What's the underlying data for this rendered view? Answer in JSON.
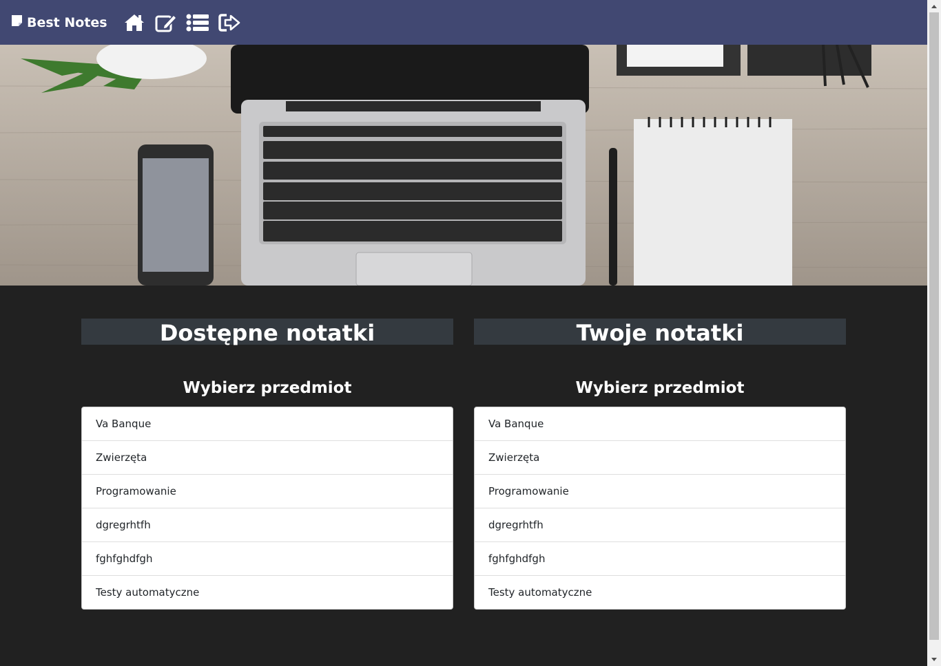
{
  "navbar": {
    "brand": "Best Notes",
    "icons": [
      "note-icon",
      "home-icon",
      "edit-icon",
      "list-icon",
      "logout-icon"
    ]
  },
  "colors": {
    "navbar_bg": "#414872",
    "page_bg": "#212121",
    "header_bg": "#343a40"
  },
  "left": {
    "title": "Dostępne notatki",
    "subtitle": "Wybierz przedmiot",
    "items": [
      {
        "label": "Va Banque"
      },
      {
        "label": "Zwierzęta"
      },
      {
        "label": "Programowanie"
      },
      {
        "label": "dgregrhtfh"
      },
      {
        "label": "fghfghdfgh"
      },
      {
        "label": "Testy automatyczne"
      }
    ]
  },
  "right": {
    "title": "Twoje notatki",
    "subtitle": "Wybierz przedmiot",
    "items": [
      {
        "label": "Va Banque"
      },
      {
        "label": "Zwierzęta"
      },
      {
        "label": "Programowanie"
      },
      {
        "label": "dgregrhtfh"
      },
      {
        "label": "fghfghdfgh"
      },
      {
        "label": "Testy automatyczne"
      }
    ]
  }
}
